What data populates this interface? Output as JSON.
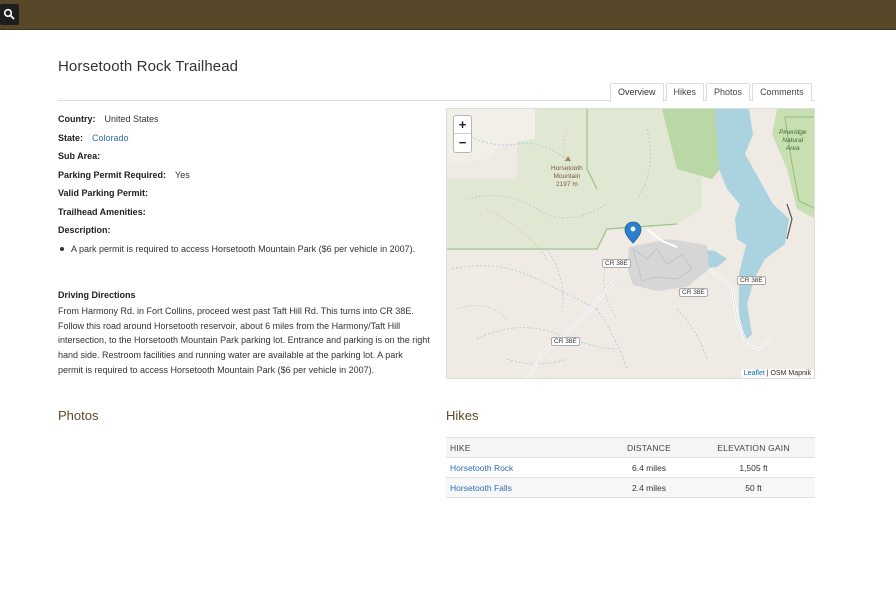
{
  "header": {
    "search_icon": "search-icon"
  },
  "page": {
    "title": "Horsetooth Rock Trailhead"
  },
  "tabs": [
    {
      "label": "Overview",
      "active": true
    },
    {
      "label": "Hikes"
    },
    {
      "label": "Photos"
    },
    {
      "label": "Comments"
    }
  ],
  "details": {
    "country_label": "Country:",
    "country_value": "United States",
    "state_label": "State:",
    "state_value": "Colorado",
    "subarea_label": "Sub Area:",
    "permit_required_label": "Parking Permit Required:",
    "permit_required_value": "Yes",
    "valid_permit_label": "Valid Parking Permit:",
    "amenities_label": "Trailhead Amenities:",
    "description_label": "Description:",
    "description_items": [
      "A park permit is required to access Horsetooth Mountain Park ($6 per vehicle in 2007)."
    ]
  },
  "driving": {
    "title": "Driving Directions",
    "text": "From Harmony Rd. in Fort Collins, proceed west past Taft Hill Rd. This turns into CR 38E. Follow this road around Horsetooth reservoir, about 6 miles from the Harmony/Taft Hill intersection, to the Horsetooth Mountain Park parking lot. Entrance and parking is on the right hand side. Restroom facilities and running water are available at the parking lot. A park permit is required to access Horsetooth Mountain Park ($6 per vehicle in 2007)."
  },
  "map": {
    "zoom_in": "+",
    "zoom_out": "−",
    "attribution_link": "Leaflet",
    "attribution_sep": " | ",
    "attribution_text": "OSM Mapnik",
    "labels": {
      "peak_name_1": "Horsetooth",
      "peak_name_2": "Mountain",
      "peak_elev": "2197 m",
      "area_1": "Pineridge",
      "area_2": "Natural",
      "area_3": "Area",
      "road": "CR 38E"
    },
    "colors": {
      "water": "#aad3df",
      "park": "#c8e0b8",
      "land": "#efeae4",
      "urban": "#d9d9d9"
    }
  },
  "photos": {
    "title": "Photos"
  },
  "hikes": {
    "title": "Hikes",
    "columns": [
      "HIKE",
      "DISTANCE",
      "ELEVATION GAIN"
    ],
    "rows": [
      {
        "name": "Horsetooth Rock",
        "distance": "6.4 miles",
        "gain": "1,505 ft"
      },
      {
        "name": "Horsetooth Falls",
        "distance": "2.4 miles",
        "gain": "50 ft"
      }
    ]
  }
}
